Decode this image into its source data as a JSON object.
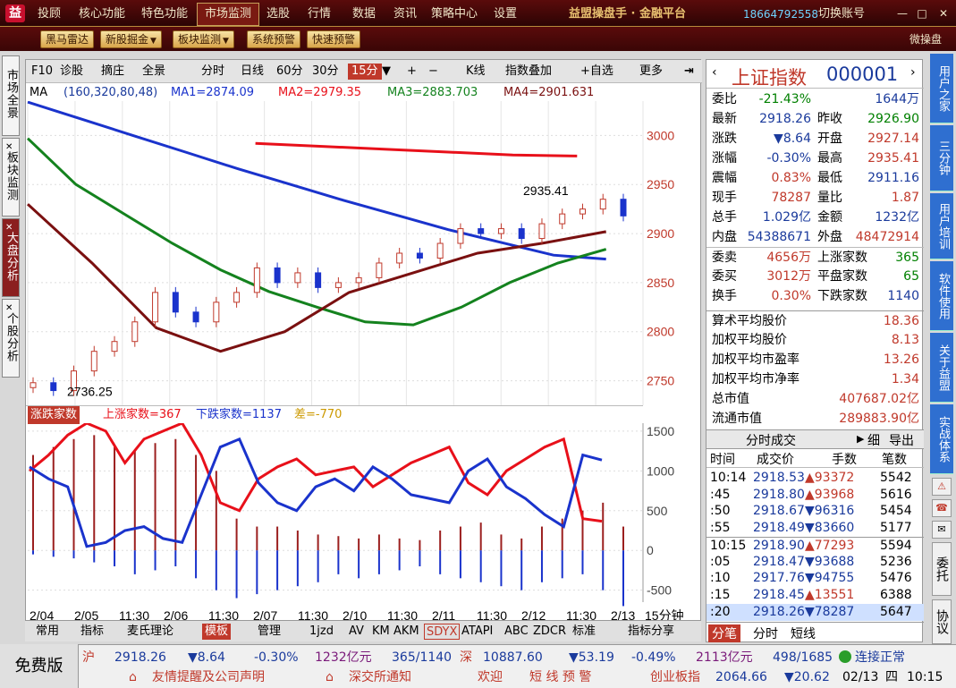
{
  "titlebar": {
    "logo": "益",
    "menus": [
      "投顾",
      "核心功能",
      "特色功能",
      "市场监测",
      "选股",
      "行情",
      "数据",
      "资讯",
      "策略中心",
      "设置"
    ],
    "active_menu": "市场监测",
    "brand": "益盟操盘手 · 金融平台",
    "phone": "18664792558",
    "switch_account": "切换账号",
    "window_buttons": [
      "—",
      "□",
      "✕"
    ]
  },
  "toolbar": {
    "buttons": [
      "黑马雷达",
      "新股掘金",
      "板块监测",
      "系统预警",
      "快速预警"
    ],
    "right_label": "微操盘"
  },
  "left_tabs": [
    "市场全景",
    "板块监测",
    "大盘分析",
    "个股分析"
  ],
  "active_left_tab": "大盘分析",
  "kline_bar": {
    "items": [
      "F10",
      "诊股",
      "摘庄",
      "全景",
      "分时",
      "日线",
      "60分",
      "30分",
      "15分",
      "+",
      "−",
      "K线",
      "指数叠加",
      "+自选",
      "更多"
    ],
    "selected": "15分"
  },
  "ma_bar": {
    "label": "MA",
    "params": "(160,320,80,48)",
    "ma1": "MA1=2874.09",
    "ma2": "MA2=2979.35",
    "ma3": "MA3=2883.703",
    "ma4": "MA4=2901.631"
  },
  "sub_indicator": {
    "name": "涨跌家数",
    "up": "上涨家数=367",
    "down": "下跌家数=1137",
    "diff": "差=-770"
  },
  "bottom_tabs": [
    "常用",
    "指标",
    "麦氏理论",
    "模板",
    "管理",
    "1jzd",
    "AV",
    "KM",
    "AKM",
    "SDYX",
    "ATAPI",
    "ABC",
    "ZDCR",
    "标准",
    "指标分享"
  ],
  "active_bottom_tab": "模板",
  "period_label": "15分钟",
  "chart_data": [
    {
      "type": "candlestick",
      "title": "上证指数 15分钟",
      "x_ticks": [
        "2/04",
        "2/05",
        "11:30",
        "2/06",
        "11:30",
        "2/07",
        "11:30",
        "2/10",
        "11:30",
        "2/11",
        "11:30",
        "2/12",
        "11:30",
        "2/13"
      ],
      "y_ticks": [
        3000,
        2950,
        2900,
        2850,
        2800,
        2750
      ],
      "ylim": [
        2725,
        3035
      ],
      "annotations": [
        {
          "text": "2935.41"
        },
        {
          "text": "2736.25"
        }
      ],
      "series": [
        {
          "name": "MA1",
          "color": "#1a33cc",
          "values": [
            3034,
            3017,
            3000,
            2983,
            2966,
            2950,
            2934,
            2919,
            2904,
            2891,
            2878,
            2874
          ]
        },
        {
          "name": "MA2",
          "color": "#e8101a",
          "values": [
            2992,
            2989,
            2986,
            2983,
            2980,
            2979
          ]
        },
        {
          "name": "MA3",
          "color": "#14821e",
          "values": [
            2997,
            2950,
            2920,
            2890,
            2863,
            2841,
            2825,
            2810,
            2807,
            2825,
            2850,
            2870,
            2884
          ]
        },
        {
          "name": "MA4",
          "color": "#7a1010",
          "values": [
            2930,
            2870,
            2804,
            2780,
            2800,
            2840,
            2860,
            2880,
            2890,
            2902
          ]
        }
      ],
      "candles": [
        2748,
        2740,
        2760,
        2780,
        2790,
        2810,
        2840,
        2820,
        2810,
        2830,
        2840,
        2865,
        2850,
        2860,
        2845,
        2850,
        2855,
        2870,
        2880,
        2875,
        2890,
        2905,
        2900,
        2905,
        2895,
        2910,
        2920,
        2925,
        2935,
        2918
      ]
    },
    {
      "type": "line",
      "title": "涨跌家数",
      "y_ticks": [
        1500,
        1000,
        500,
        0,
        -500
      ],
      "ylim": [
        -650,
        1600
      ],
      "series": [
        {
          "name": "上涨家数",
          "color": "#e8101a",
          "values": [
            1000,
            1200,
            1450,
            1600,
            1500,
            1100,
            1400,
            1500,
            1600,
            1200,
            600,
            500,
            900,
            1050,
            1150,
            950,
            1000,
            1050,
            800,
            950,
            1100,
            1200,
            1300,
            850,
            700,
            1000,
            1150,
            1300,
            1400,
            400,
            367
          ]
        },
        {
          "name": "下跌家数",
          "color": "#1a33cc",
          "values": [
            1050,
            900,
            800,
            50,
            100,
            250,
            300,
            150,
            100,
            700,
            1300,
            1400,
            850,
            600,
            500,
            800,
            900,
            750,
            1050,
            900,
            700,
            650,
            600,
            1000,
            1150,
            800,
            650,
            450,
            300,
            1200,
            1137
          ]
        }
      ],
      "bars_up": [
        1200,
        1300,
        1400,
        1450,
        1300,
        1250,
        1350,
        1400,
        1200,
        1000,
        400,
        300,
        300,
        250,
        200,
        180,
        150,
        200,
        150,
        130,
        250,
        300,
        350,
        200,
        150,
        300,
        400,
        500,
        600,
        300
      ],
      "bars_down": [
        -50,
        -80,
        -100,
        -150,
        -200,
        -300,
        -250,
        -200,
        -350,
        -500,
        -600,
        -550,
        -500,
        -450,
        -400,
        -300,
        -350,
        -300,
        -250,
        -200,
        -300,
        -350,
        -400,
        -450,
        -500,
        -400,
        -350,
        -300,
        -500,
        -700
      ]
    }
  ],
  "quote": {
    "name": "上证指数",
    "code": "000001",
    "rows": [
      {
        "l1": "委比",
        "v1": "-21.43%",
        "l2": "",
        "v2": "1644万"
      },
      {
        "l1": "最新",
        "v1": "2918.26",
        "l2": "昨收",
        "v2": "2926.90"
      },
      {
        "l1": "涨跌",
        "v1": "▼8.64",
        "l2": "开盘",
        "v2": "2927.14"
      },
      {
        "l1": "涨幅",
        "v1": "-0.30%",
        "l2": "最高",
        "v2": "2935.41"
      },
      {
        "l1": "震幅",
        "v1": "0.83%",
        "l2": "最低",
        "v2": "2911.16"
      },
      {
        "l1": "现手",
        "v1": "78287",
        "l2": "量比",
        "v2": "1.87"
      },
      {
        "l1": "总手",
        "v1": "1.029亿",
        "l2": "金额",
        "v2": "1232亿"
      },
      {
        "l1": "内盘",
        "v1": "54388671",
        "l2": "外盘",
        "v2": "48472914"
      },
      {
        "l1": "委卖",
        "v1": "4656万",
        "l2": "上涨家数",
        "v2": "365"
      },
      {
        "l1": "委买",
        "v1": "3012万",
        "l2": "平盘家数",
        "v2": "65"
      },
      {
        "l1": "换手",
        "v1": "0.30%",
        "l2": "下跌家数",
        "v2": "1140"
      }
    ],
    "stats": [
      {
        "label": "算术平均股价",
        "value": "18.36"
      },
      {
        "label": "加权平均股价",
        "value": "8.13"
      },
      {
        "label": "加权平均市盈率",
        "value": "13.26"
      },
      {
        "label": "加权平均市净率",
        "value": "1.34"
      },
      {
        "label": "总市值",
        "value": "407687.02亿"
      },
      {
        "label": "流通市值",
        "value": "289883.90亿"
      }
    ]
  },
  "trades": {
    "tab_title": "分时成交",
    "tab_detail": "细",
    "tab_export": "导出",
    "headers": [
      "时间",
      "成交价",
      "手数",
      "笔数"
    ],
    "rows": [
      {
        "t": "10:14",
        "p": "2918.53",
        "h": "▲93372",
        "n": "5542"
      },
      {
        "t": ":45",
        "p": "2918.80",
        "h": "▲93968",
        "n": "5616"
      },
      {
        "t": ":50",
        "p": "2918.67",
        "h": "▼96316",
        "n": "5454"
      },
      {
        "t": ":55",
        "p": "2918.49",
        "h": "▼83660",
        "n": "5177"
      },
      {
        "t": "10:15",
        "p": "2918.90",
        "h": "▲77293",
        "n": "5594"
      },
      {
        "t": ":05",
        "p": "2918.47",
        "h": "▼93688",
        "n": "5236"
      },
      {
        "t": ":10",
        "p": "2917.76",
        "h": "▼94755",
        "n": "5476"
      },
      {
        "t": ":15",
        "p": "2918.45",
        "h": "▲13551",
        "n": "6388"
      },
      {
        "t": ":20",
        "p": "2918.26",
        "h": "▼78287",
        "n": "5647"
      }
    ],
    "bottom_tabs": [
      "分笔",
      "分时",
      "短线"
    ]
  },
  "side_tabs": [
    "用户之家",
    "三分钟",
    "用户培训",
    "软件使用",
    "关于益盟",
    "实战体系"
  ],
  "side_icons": [
    "⚠",
    "☎",
    "✉",
    "委托",
    "协议"
  ],
  "status": {
    "free": "免费版",
    "sh_label": "沪",
    "sh_price": "2918.26",
    "sh_change": "▼8.64",
    "sh_pct": "-0.30%",
    "sh_amount": "1232亿元",
    "sh_updown": "365/1140",
    "sz_label": "深",
    "sz_price": "10887.60",
    "sz_change": "▼53.19",
    "sz_pct": "-0.49%",
    "sz_amount": "2113亿元",
    "sz_updown": "498/1685",
    "connect": "连接正常",
    "ticker1": "友情提醒及公司声明",
    "ticker2": "深交所通知",
    "ticker3": "欢迎",
    "ticker4": "短 线 预 警",
    "cyb_label": "创业板指",
    "cyb_price": "2064.66",
    "cyb_change": "▼20.62",
    "date": "02/13",
    "weekday": "四",
    "time": "10:15"
  }
}
